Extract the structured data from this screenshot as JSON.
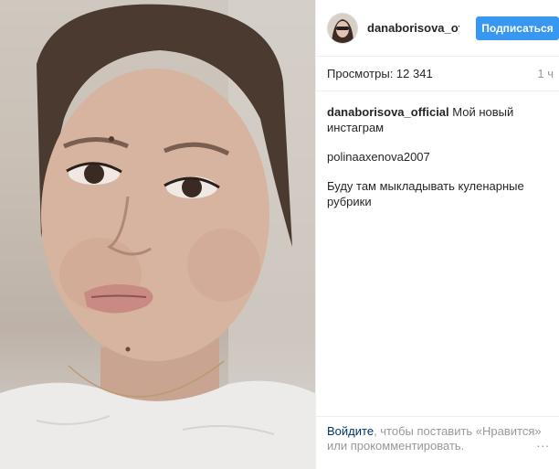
{
  "header": {
    "username": "danaborisova_of...",
    "follow_label": "Подписаться"
  },
  "stats": {
    "views": "Просмотры: 12 341",
    "time": "1 ч"
  },
  "comments": [
    {
      "author": "danaborisova_official",
      "text": " Мой новый инстаграм"
    },
    {
      "author": "",
      "text": "polinaaxenova2007"
    },
    {
      "author": "",
      "text": "Буду там мыкладывать куленарные рубрики"
    }
  ],
  "footer": {
    "login_link": "Войдите",
    "prompt": ", чтобы поставить «Нравится» или прокомментировать.",
    "more": "..."
  }
}
